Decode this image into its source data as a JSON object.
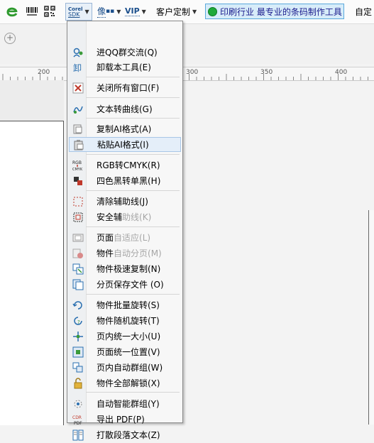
{
  "toolbar": {
    "corel_top": "Corel",
    "corel_bottom": "SDK",
    "pixel_label": "像",
    "vip_label": "VIP",
    "custom_label": "客户定制",
    "banner_text": "印刷行业 最专业的条码制作工具",
    "right_text": "自定"
  },
  "ruler": {
    "ticks": [
      "200",
      "300",
      "350",
      "400"
    ]
  },
  "menu": {
    "items": [
      {
        "label": "进QQ群交流(Q)",
        "icon": "qq-group-icon",
        "grey": ""
      },
      {
        "label": "卸载本工具(E)",
        "icon": "uninstall-icon",
        "grey": ""
      },
      {
        "label": "关闭所有窗口(F)",
        "icon": "close-windows-icon",
        "grey": ""
      },
      {
        "label": "文本转曲线(G)",
        "icon": "text-to-curve-icon",
        "grey": ""
      },
      {
        "label": "复制AI格式(A)",
        "icon": "copy-ai-icon",
        "grey": ""
      },
      {
        "label": "粘贴AI格式(I)",
        "icon": "paste-ai-icon",
        "grey": ""
      },
      {
        "label": "RGB转CMYK(R)",
        "icon": "rgb-cmyk-icon",
        "grey": ""
      },
      {
        "label": "四色黑转单黑(H)",
        "icon": "black-convert-icon",
        "grey": ""
      },
      {
        "label": "清除辅助线(J)",
        "icon": "clear-guides-icon",
        "grey": ""
      },
      {
        "label": "安全辅",
        "icon": "safe-guides-icon",
        "grey": "助线(K)"
      },
      {
        "label": "页面",
        "icon": "page-fit-icon",
        "grey": "自适应(L)"
      },
      {
        "label": "物件",
        "icon": "auto-paginate-icon",
        "grey": "自动分页(M)"
      },
      {
        "label": "物件极速复制(N)",
        "icon": "fast-copy-icon",
        "grey": ""
      },
      {
        "label": "分页保存文件 (O)",
        "icon": "save-pages-icon",
        "grey": ""
      },
      {
        "label": "物件批量旋转(S)",
        "icon": "batch-rotate-icon",
        "grey": ""
      },
      {
        "label": "物件随机旋转(T)",
        "icon": "random-rotate-icon",
        "grey": ""
      },
      {
        "label": "页内统一大小(U)",
        "icon": "uniform-size-icon",
        "grey": ""
      },
      {
        "label": "页面统一位置(V)",
        "icon": "uniform-position-icon",
        "grey": ""
      },
      {
        "label": "页内自动群组(W)",
        "icon": "auto-group-icon",
        "grey": ""
      },
      {
        "label": "物件全部解锁(X)",
        "icon": "unlock-all-icon",
        "grey": ""
      },
      {
        "label": "自动智能群组(Y)",
        "icon": "smart-group-icon",
        "grey": ""
      },
      {
        "label": "导出 PDF(P)",
        "icon": "export-pdf-icon",
        "grey": ""
      },
      {
        "label": "打散段落文本(Z)",
        "icon": "break-paragraph-icon",
        "grey": ""
      }
    ],
    "icon_mini": {
      "corel": "Corel",
      "rgb": "RGB",
      "cmyk": "CMYK",
      "cdr": "CDR",
      "pdf": "PDF",
      "xie": "卸"
    }
  }
}
